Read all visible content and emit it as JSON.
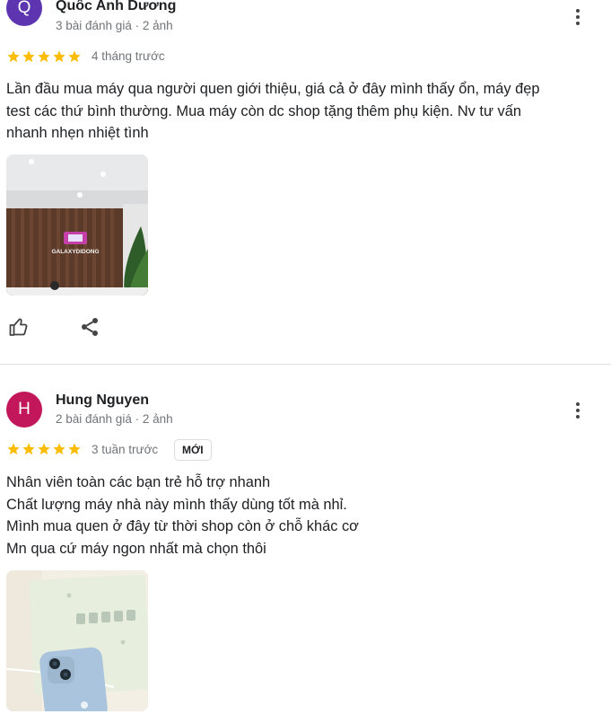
{
  "reviews": [
    {
      "avatar_letter": "Q",
      "avatar_color": "#5e35b1",
      "name": "Quốc Anh Dương",
      "meta": "3 bài đánh giá · 2 ảnh",
      "rating": 5,
      "when": "4 tháng trước",
      "text_lines": [
        "Lần đầu mua máy qua người quen giới thiệu, giá cả ở đây mình thấy ổn, máy đẹp",
        "test các thứ bình thường. Mua máy còn dc shop tặng thêm phụ kiện. Nv tư vấn",
        "nhanh nhẹn nhiệt tình"
      ],
      "photo_sign_text": "GALAXYDIDONG"
    },
    {
      "avatar_letter": "H",
      "avatar_color": "#c2185b",
      "name": "Hung Nguyen",
      "meta": "2 bài đánh giá · 2 ảnh",
      "rating": 5,
      "when": "3 tuần trước",
      "badge": "MỚI",
      "text_lines": [
        "Nhân viên toàn các bạn trẻ hỗ trợ nhanh",
        "Chất lượng máy nhà này mình thấy dùng tốt mà nhỉ.",
        "Mình mua quen ở đây từ thời shop còn ở chỗ khác cơ",
        "Mn qua cứ máy ngon nhất mà chọn thôi"
      ]
    }
  ],
  "colors": {
    "star": "#fbbc04",
    "divider": "#e0e0e0"
  },
  "icons": {
    "more": "more-vert-icon",
    "like": "thumb-up-icon",
    "share": "share-icon",
    "star": "star-icon"
  }
}
